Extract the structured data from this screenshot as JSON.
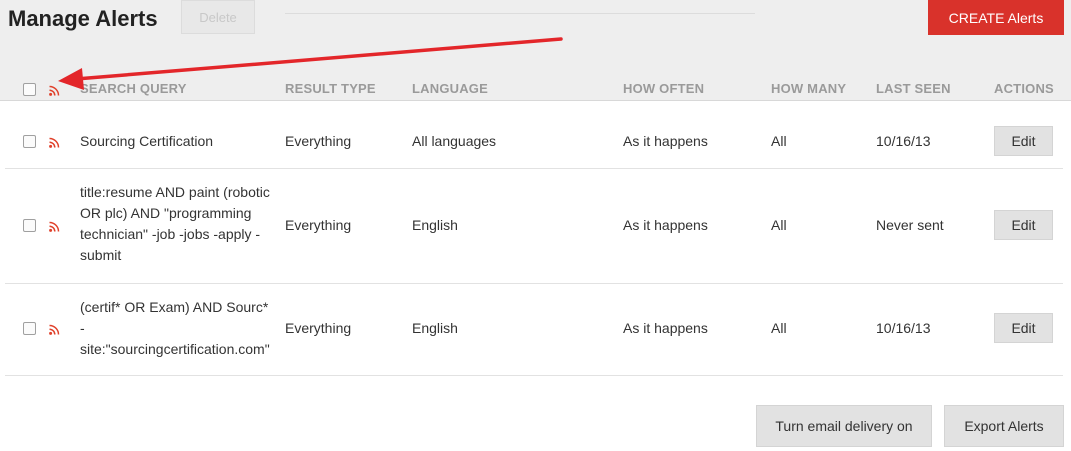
{
  "header": {
    "title": "Manage Alerts",
    "delete_label": "Delete",
    "create_label": "CREATE Alerts"
  },
  "colors": {
    "accent": "#d9322b",
    "rss": "#e0402a",
    "annotation_arrow": "#e3262a"
  },
  "icons": [
    "rss-icon",
    "checkbox",
    "annotation-arrow"
  ],
  "table": {
    "columns": [
      "SEARCH QUERY",
      "RESULT TYPE",
      "LANGUAGE",
      "HOW OFTEN",
      "HOW MANY",
      "LAST SEEN",
      "ACTIONS"
    ],
    "rows": [
      {
        "query": "Sourcing Certification",
        "result_type": "Everything",
        "language": "All languages",
        "how_often": "As it happens",
        "how_many": "All",
        "last_seen": "10/16/13",
        "action": "Edit"
      },
      {
        "query": "title:resume AND paint (robotic OR plc) AND \"programming technician\" -job -jobs -apply -submit",
        "result_type": "Everything",
        "language": "English",
        "how_often": "As it happens",
        "how_many": "All",
        "last_seen": "Never sent",
        "action": "Edit"
      },
      {
        "query": "(certif* OR Exam) AND Sourc* -site:\"sourcingcertification.com\"",
        "result_type": "Everything",
        "language": "English",
        "how_often": "As it happens",
        "how_many": "All",
        "last_seen": "10/16/13",
        "action": "Edit"
      }
    ]
  },
  "footer": {
    "email_delivery_label": "Turn email delivery on",
    "export_label": "Export Alerts"
  }
}
